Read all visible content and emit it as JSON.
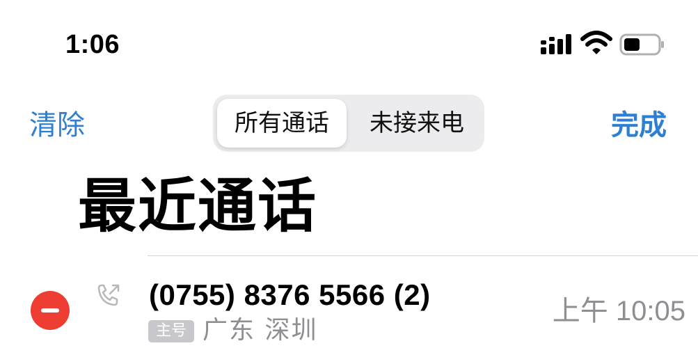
{
  "status_bar": {
    "time": "1:06",
    "icons": [
      "cellular-signal-icon",
      "wifi-icon",
      "battery-icon"
    ]
  },
  "nav": {
    "clear_label": "清除",
    "done_label": "完成",
    "segments": [
      {
        "label": "所有通话",
        "selected": true
      },
      {
        "label": "未接来电",
        "selected": false
      }
    ]
  },
  "title": "最近通话",
  "calls": [
    {
      "number": "(0755) 8376 5566 (2)",
      "label_badge": "主号",
      "location": "广东 深圳",
      "time": "上午 10:05",
      "call_type_icon": "outgoing-call-icon"
    }
  ],
  "colors": {
    "accent": "#2d7fd3",
    "delete": "#ee3d32",
    "secondary_text": "#8e8e93",
    "badge_bg": "#c7c7cc"
  }
}
